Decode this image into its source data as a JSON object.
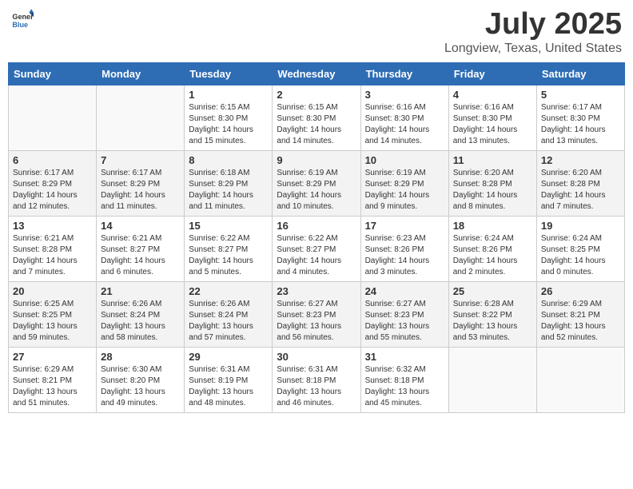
{
  "logo": {
    "general": "General",
    "blue": "Blue"
  },
  "title": "July 2025",
  "location": "Longview, Texas, United States",
  "weekdays": [
    "Sunday",
    "Monday",
    "Tuesday",
    "Wednesday",
    "Thursday",
    "Friday",
    "Saturday"
  ],
  "weeks": [
    [
      {
        "day": "",
        "info": ""
      },
      {
        "day": "",
        "info": ""
      },
      {
        "day": "1",
        "info": "Sunrise: 6:15 AM\nSunset: 8:30 PM\nDaylight: 14 hours and 15 minutes."
      },
      {
        "day": "2",
        "info": "Sunrise: 6:15 AM\nSunset: 8:30 PM\nDaylight: 14 hours and 14 minutes."
      },
      {
        "day": "3",
        "info": "Sunrise: 6:16 AM\nSunset: 8:30 PM\nDaylight: 14 hours and 14 minutes."
      },
      {
        "day": "4",
        "info": "Sunrise: 6:16 AM\nSunset: 8:30 PM\nDaylight: 14 hours and 13 minutes."
      },
      {
        "day": "5",
        "info": "Sunrise: 6:17 AM\nSunset: 8:30 PM\nDaylight: 14 hours and 13 minutes."
      }
    ],
    [
      {
        "day": "6",
        "info": "Sunrise: 6:17 AM\nSunset: 8:29 PM\nDaylight: 14 hours and 12 minutes."
      },
      {
        "day": "7",
        "info": "Sunrise: 6:17 AM\nSunset: 8:29 PM\nDaylight: 14 hours and 11 minutes."
      },
      {
        "day": "8",
        "info": "Sunrise: 6:18 AM\nSunset: 8:29 PM\nDaylight: 14 hours and 11 minutes."
      },
      {
        "day": "9",
        "info": "Sunrise: 6:19 AM\nSunset: 8:29 PM\nDaylight: 14 hours and 10 minutes."
      },
      {
        "day": "10",
        "info": "Sunrise: 6:19 AM\nSunset: 8:29 PM\nDaylight: 14 hours and 9 minutes."
      },
      {
        "day": "11",
        "info": "Sunrise: 6:20 AM\nSunset: 8:28 PM\nDaylight: 14 hours and 8 minutes."
      },
      {
        "day": "12",
        "info": "Sunrise: 6:20 AM\nSunset: 8:28 PM\nDaylight: 14 hours and 7 minutes."
      }
    ],
    [
      {
        "day": "13",
        "info": "Sunrise: 6:21 AM\nSunset: 8:28 PM\nDaylight: 14 hours and 7 minutes."
      },
      {
        "day": "14",
        "info": "Sunrise: 6:21 AM\nSunset: 8:27 PM\nDaylight: 14 hours and 6 minutes."
      },
      {
        "day": "15",
        "info": "Sunrise: 6:22 AM\nSunset: 8:27 PM\nDaylight: 14 hours and 5 minutes."
      },
      {
        "day": "16",
        "info": "Sunrise: 6:22 AM\nSunset: 8:27 PM\nDaylight: 14 hours and 4 minutes."
      },
      {
        "day": "17",
        "info": "Sunrise: 6:23 AM\nSunset: 8:26 PM\nDaylight: 14 hours and 3 minutes."
      },
      {
        "day": "18",
        "info": "Sunrise: 6:24 AM\nSunset: 8:26 PM\nDaylight: 14 hours and 2 minutes."
      },
      {
        "day": "19",
        "info": "Sunrise: 6:24 AM\nSunset: 8:25 PM\nDaylight: 14 hours and 0 minutes."
      }
    ],
    [
      {
        "day": "20",
        "info": "Sunrise: 6:25 AM\nSunset: 8:25 PM\nDaylight: 13 hours and 59 minutes."
      },
      {
        "day": "21",
        "info": "Sunrise: 6:26 AM\nSunset: 8:24 PM\nDaylight: 13 hours and 58 minutes."
      },
      {
        "day": "22",
        "info": "Sunrise: 6:26 AM\nSunset: 8:24 PM\nDaylight: 13 hours and 57 minutes."
      },
      {
        "day": "23",
        "info": "Sunrise: 6:27 AM\nSunset: 8:23 PM\nDaylight: 13 hours and 56 minutes."
      },
      {
        "day": "24",
        "info": "Sunrise: 6:27 AM\nSunset: 8:23 PM\nDaylight: 13 hours and 55 minutes."
      },
      {
        "day": "25",
        "info": "Sunrise: 6:28 AM\nSunset: 8:22 PM\nDaylight: 13 hours and 53 minutes."
      },
      {
        "day": "26",
        "info": "Sunrise: 6:29 AM\nSunset: 8:21 PM\nDaylight: 13 hours and 52 minutes."
      }
    ],
    [
      {
        "day": "27",
        "info": "Sunrise: 6:29 AM\nSunset: 8:21 PM\nDaylight: 13 hours and 51 minutes."
      },
      {
        "day": "28",
        "info": "Sunrise: 6:30 AM\nSunset: 8:20 PM\nDaylight: 13 hours and 49 minutes."
      },
      {
        "day": "29",
        "info": "Sunrise: 6:31 AM\nSunset: 8:19 PM\nDaylight: 13 hours and 48 minutes."
      },
      {
        "day": "30",
        "info": "Sunrise: 6:31 AM\nSunset: 8:18 PM\nDaylight: 13 hours and 46 minutes."
      },
      {
        "day": "31",
        "info": "Sunrise: 6:32 AM\nSunset: 8:18 PM\nDaylight: 13 hours and 45 minutes."
      },
      {
        "day": "",
        "info": ""
      },
      {
        "day": "",
        "info": ""
      }
    ]
  ]
}
